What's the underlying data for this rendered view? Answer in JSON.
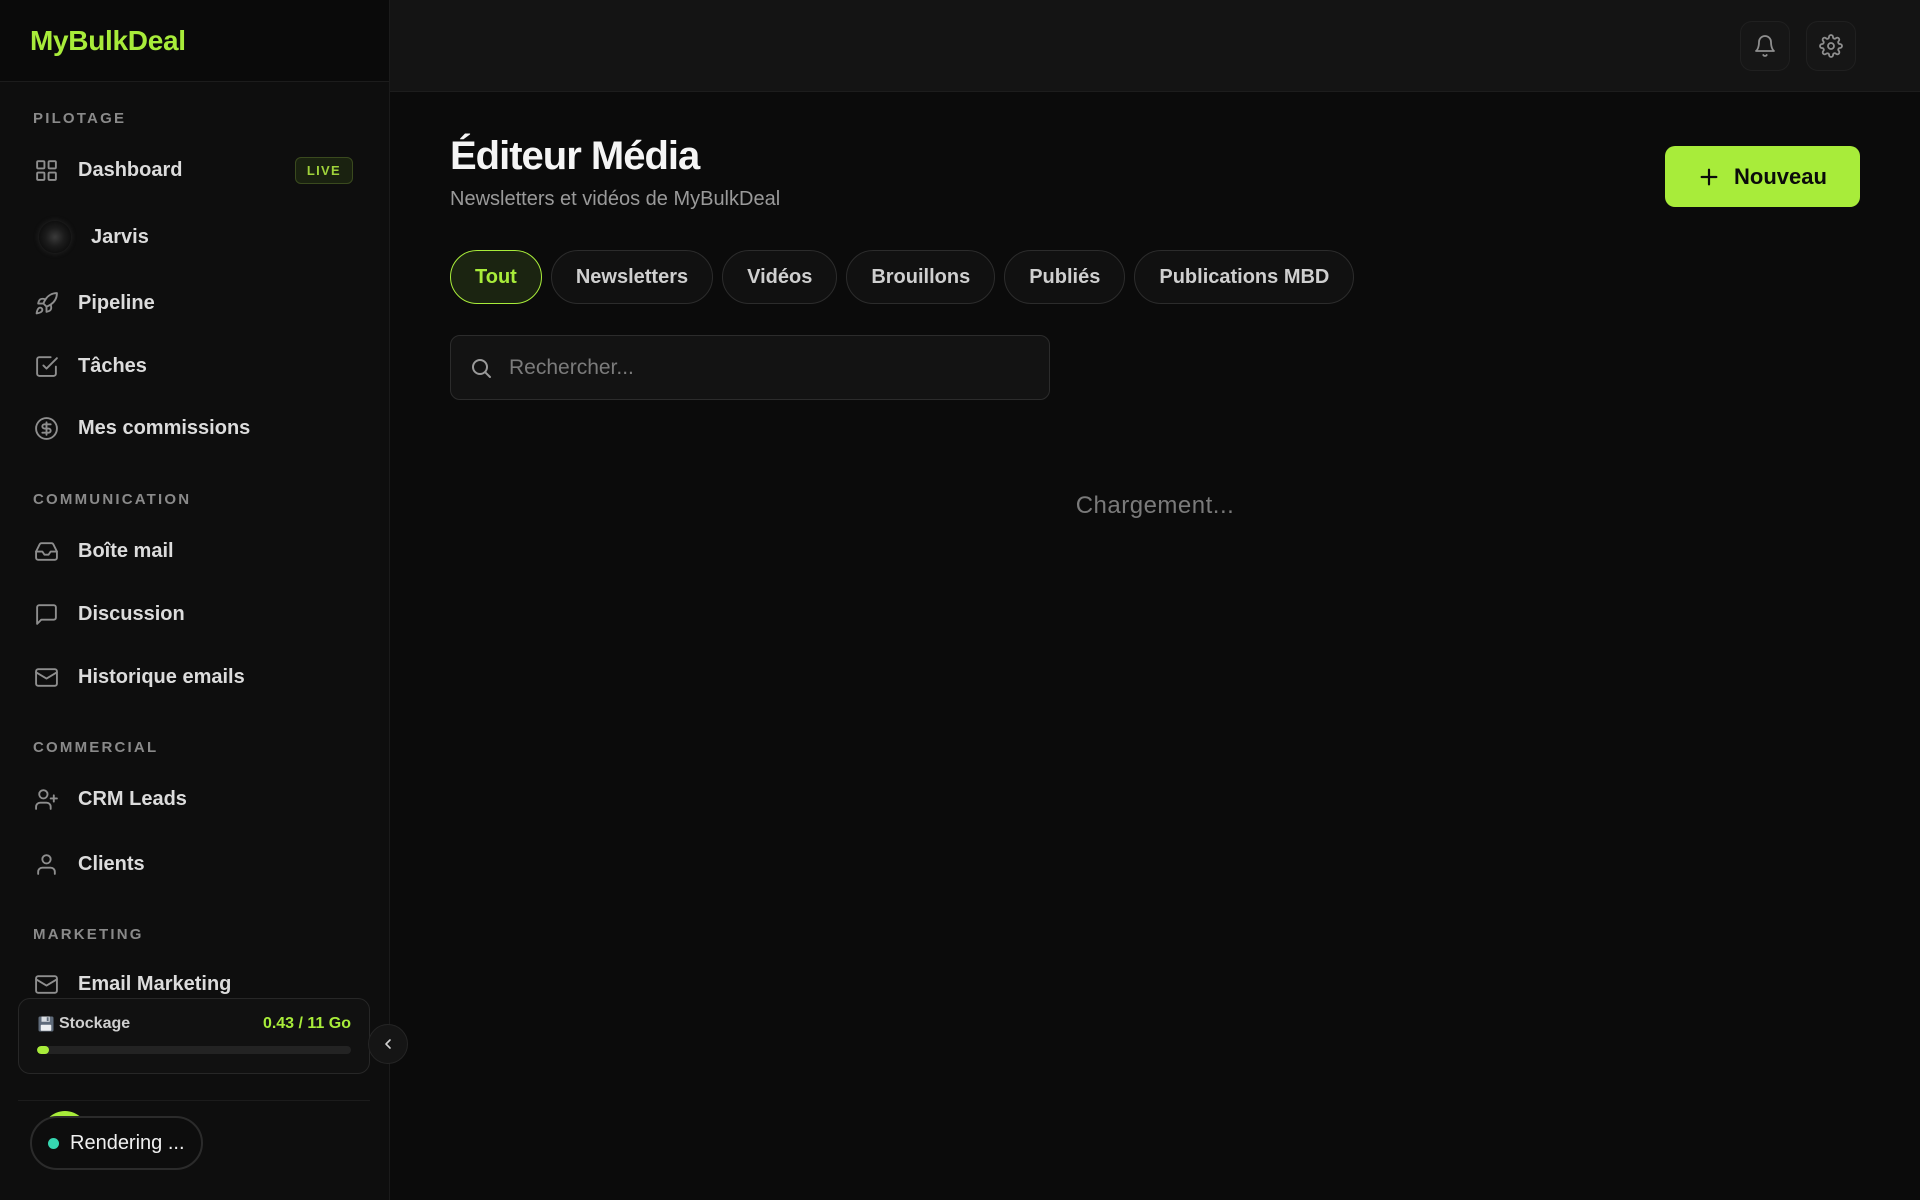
{
  "brand": {
    "name": "MyBulkDeal"
  },
  "sidebar": {
    "sections": [
      {
        "label": "PILOTAGE"
      },
      {
        "label": "COMMUNICATION"
      },
      {
        "label": "COMMERCIAL"
      },
      {
        "label": "MARKETING"
      }
    ],
    "items": [
      {
        "label": "Dashboard",
        "icon": "grid-icon",
        "badge": "LIVE"
      },
      {
        "label": "Jarvis",
        "icon": "jarvis-orb-icon"
      },
      {
        "label": "Pipeline",
        "icon": "rocket-icon"
      },
      {
        "label": "Tâches",
        "icon": "checkbox-icon"
      },
      {
        "label": "Mes commissions",
        "icon": "dollar-circle-icon"
      },
      {
        "label": "Boîte mail",
        "icon": "inbox-icon"
      },
      {
        "label": "Discussion",
        "icon": "chat-icon"
      },
      {
        "label": "Historique emails",
        "icon": "mail-icon"
      },
      {
        "label": "CRM Leads",
        "icon": "user-plus-icon"
      },
      {
        "label": "Clients",
        "icon": "user-icon"
      },
      {
        "label": "Email Marketing",
        "icon": "mail-icon"
      }
    ],
    "storage": {
      "label": "Stockage",
      "value": "0.43 / 11 Go",
      "used_fraction": 0.039
    },
    "status": {
      "text": "Rendering ...",
      "color": "#36d6b0"
    }
  },
  "topbar": {
    "icons": [
      "bell-icon",
      "gear-icon"
    ]
  },
  "main": {
    "title": "Éditeur Média",
    "subtitle": "Newsletters et vidéos de MyBulkDeal",
    "new_button": "Nouveau",
    "tabs": [
      {
        "label": "Tout",
        "active": true
      },
      {
        "label": "Newsletters",
        "active": false
      },
      {
        "label": "Vidéos",
        "active": false
      },
      {
        "label": "Brouillons",
        "active": false
      },
      {
        "label": "Publiés",
        "active": false
      },
      {
        "label": "Publications MBD",
        "active": false
      }
    ],
    "search": {
      "placeholder": "Rechercher...",
      "value": ""
    },
    "loading_text": "Chargement..."
  },
  "colors": {
    "accent": "#a8ec3a",
    "background": "#0b0b0b",
    "status_dot": "#36d6b0"
  }
}
